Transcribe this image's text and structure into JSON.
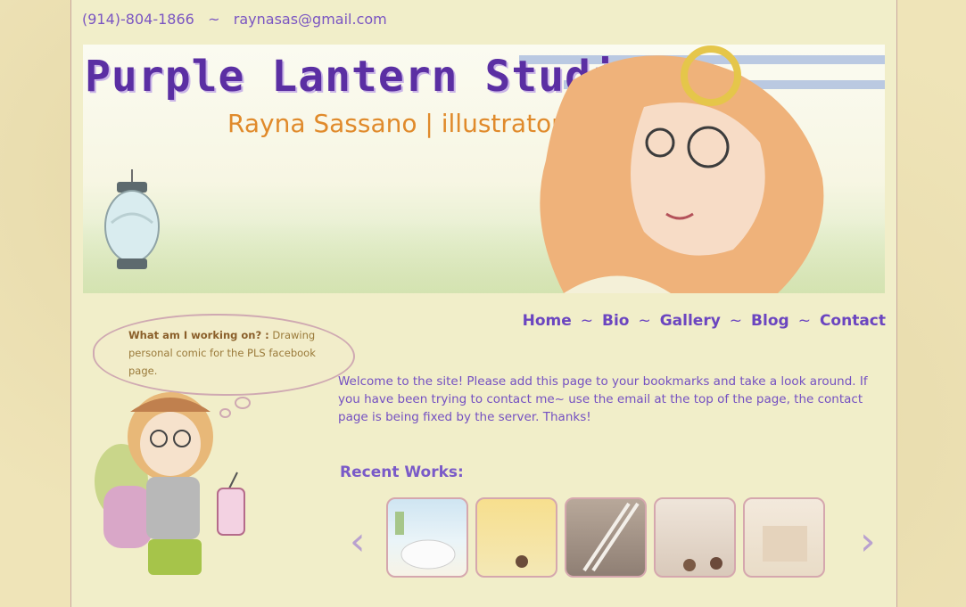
{
  "header": {
    "phone": "(914)-804-1866",
    "separator": "~",
    "email": "raynasas@gmail.com"
  },
  "banner": {
    "title": "Purple Lantern Studio",
    "subtitle": "Rayna Sassano | illustrator"
  },
  "nav": {
    "items": [
      {
        "label": "Home"
      },
      {
        "label": "Bio"
      },
      {
        "label": "Gallery"
      },
      {
        "label": "Blog"
      },
      {
        "label": "Contact"
      }
    ],
    "separator": "~"
  },
  "sidebar": {
    "working_on_label": "What am I working on? :",
    "working_on_text": "Drawing personal comic for the PLS facebook page."
  },
  "main": {
    "welcome": "Welcome to the site! Please add this page to your bookmarks and take a look around. If you have been trying to contact me~ use the email at the top of the page, the contact page is being fixed by the server. Thanks!",
    "recent_title": "Recent Works:"
  },
  "recent_works": {
    "count": 5,
    "prev_icon": "left-arrow-icon",
    "next_icon": "right-arrow-icon"
  },
  "colors": {
    "accent": "#6b45c0",
    "title": "#5b2fa3",
    "subtitle": "#e08a2b",
    "frame": "#d5a7ae"
  }
}
